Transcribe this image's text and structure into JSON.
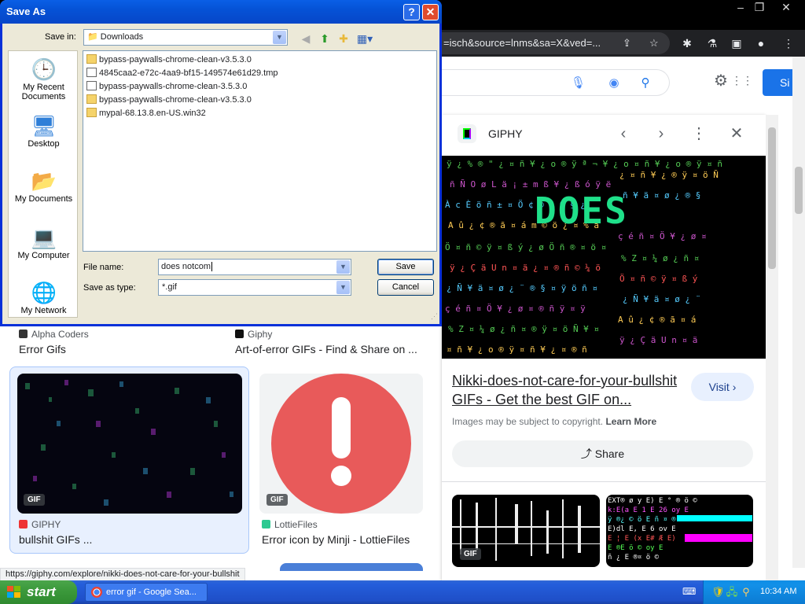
{
  "chrome": {
    "window_controls": [
      "–",
      "❐",
      "✕"
    ],
    "omnibox_text": "=isch&source=lnms&sa=X&ved=...",
    "signin_label": "Si"
  },
  "results": {
    "tile1": {
      "source": "Alpha Coders",
      "title": "Error Gifs"
    },
    "tile2": {
      "source": "Giphy",
      "title": "Art-of-error GIFs - Find & Share on ..."
    },
    "tile3": {
      "source": "GIPHY",
      "title": "bullshit GIFs ...",
      "badge": "GIF"
    },
    "tile4": {
      "source": "LottieFiles",
      "title": "Error icon by Minji - LottieFiles",
      "badge": "GIF"
    }
  },
  "panel": {
    "source": "GIPHY",
    "preview_text": "DOES",
    "title": "Nikki-does-not-care-for-your-bullshit GIFs - Get the best GIF on...",
    "visit_label": "Visit",
    "copyright_text": "Images may be subject to copyright.",
    "learn_more": "Learn More",
    "share_label": "Share",
    "related_badge": "GIF"
  },
  "status_url": "https://giphy.com/explore/nikki-does-not-care-for-your-bullshit",
  "dialog": {
    "title": "Save As",
    "save_in_label": "Save in:",
    "save_in_value": "Downloads",
    "places": [
      "My Recent Documents",
      "Desktop",
      "My Documents",
      "My Computer",
      "My Network"
    ],
    "files": [
      "bypass-paywalls-chrome-clean-v3.5.3.0",
      "4845caa2-e72c-4aa9-bf15-149574e61d29.tmp",
      "bypass-paywalls-chrome-clean-3.5.3.0",
      "bypass-paywalls-chrome-clean-v3.5.3.0",
      "mypal-68.13.8.en-US.win32"
    ],
    "file_name_label": "File name:",
    "file_name_value": "does notcom",
    "save_type_label": "Save as type:",
    "save_type_value": "*.gif",
    "save_button": "Save",
    "cancel_button": "Cancel"
  },
  "taskbar": {
    "start_label": "start",
    "task_label": "error gif - Google Sea...",
    "clock": "10:34 AM"
  },
  "colors": {
    "xp_blue": "#0831d9",
    "google_blue": "#1a73e8",
    "start_green": "#3c9a3c"
  }
}
